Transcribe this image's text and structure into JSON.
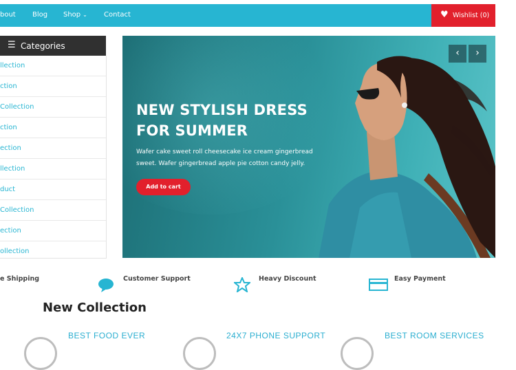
{
  "nav": {
    "items": [
      "bout",
      "Blog",
      "Shop",
      "Contact"
    ],
    "wishlist": "Wishlist  (0)"
  },
  "categories": {
    "title": "Categories",
    "items": [
      "llection",
      "ction",
      "Collection",
      "ction",
      "ection",
      "llection",
      "duct",
      "Collection",
      "ection",
      "ollection"
    ]
  },
  "hero": {
    "title_line1": "NEW STYLISH DRESS",
    "title_line2": "FOR SUMMER",
    "text_line1": "Wafer cake sweet roll cheesecake ice cream gingerbread",
    "text_line2": "sweet. Wafer gingerbread apple pie cotton candy jelly.",
    "button": "Add to cart",
    "prev": "‹",
    "next": "›"
  },
  "features": [
    "e Shipping",
    "Customer Support",
    "Heavy Discount",
    "Easy Payment"
  ],
  "section_title": "New Collection",
  "promos": [
    "BEST FOOD EVER",
    "24X7 PHONE SUPPORT",
    "BEST ROOM SERVICES"
  ],
  "colors": {
    "accent": "#27b5d2",
    "red": "#e2202c",
    "dark": "#303030"
  }
}
